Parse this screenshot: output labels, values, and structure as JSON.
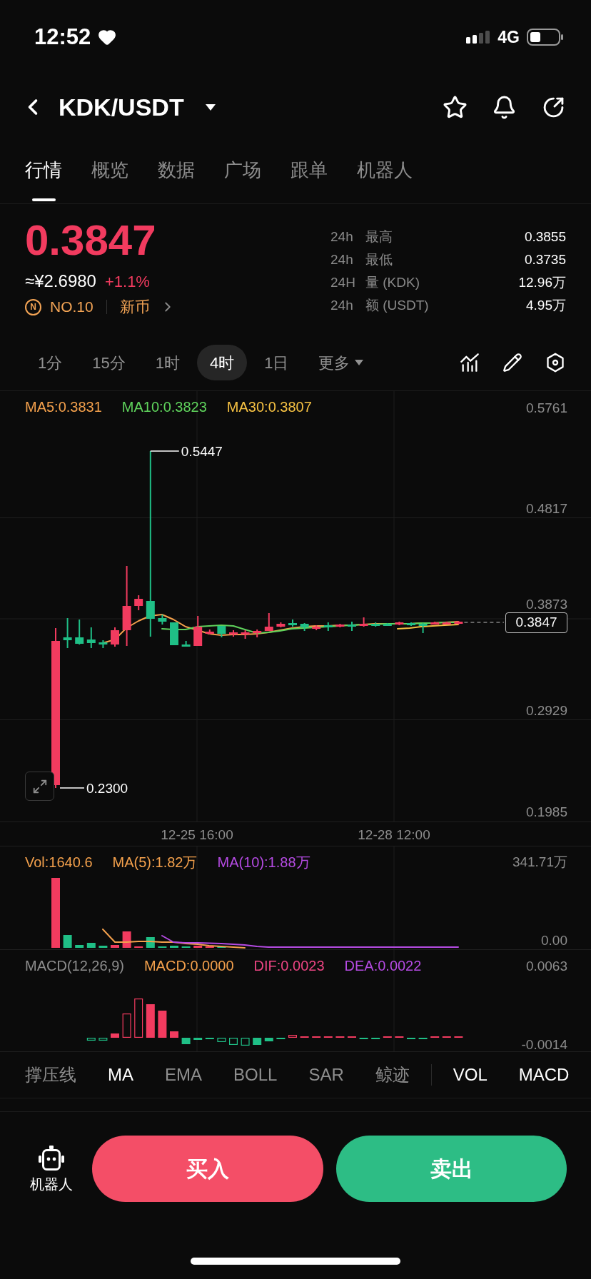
{
  "status_bar": {
    "time": "12:52",
    "network": "4G"
  },
  "header": {
    "pair": "KDK/USDT"
  },
  "tabs": [
    {
      "label": "行情",
      "selected": true
    },
    {
      "label": "概览",
      "selected": false
    },
    {
      "label": "数据",
      "selected": false
    },
    {
      "label": "广场",
      "selected": false
    },
    {
      "label": "跟单",
      "selected": false
    },
    {
      "label": "机器人",
      "selected": false
    }
  ],
  "ticker": {
    "price": "0.3847",
    "fiat_price": "≈¥2.6980",
    "change": "+1.1%",
    "rank_badge": "N",
    "rank": "NO.10",
    "tag": "新币",
    "stats": [
      {
        "period": "24h",
        "label": "最高",
        "value": "0.3855"
      },
      {
        "period": "24h",
        "label": "最低",
        "value": "0.3735"
      },
      {
        "period": "24H",
        "label": "量 (KDK)",
        "value": "12.96万"
      },
      {
        "period": "24h",
        "label": "额 (USDT)",
        "value": "4.95万"
      }
    ]
  },
  "intervals": [
    {
      "label": "1分",
      "selected": false,
      "kind": "option"
    },
    {
      "label": "15分",
      "selected": false,
      "kind": "option"
    },
    {
      "label": "1时",
      "selected": false,
      "kind": "option"
    },
    {
      "label": "4时",
      "selected": true,
      "kind": "option"
    },
    {
      "label": "1日",
      "selected": false,
      "kind": "option"
    },
    {
      "label": "更多",
      "selected": false,
      "kind": "dropdown"
    }
  ],
  "chart": {
    "legend": [
      {
        "label": "MA5:0.3831",
        "color": "#f3a04c"
      },
      {
        "label": "MA10:0.3823",
        "color": "#5fd35c"
      },
      {
        "label": "MA30:0.3807",
        "color": "#f5c143"
      }
    ],
    "y_axis": [
      "0.5761",
      "0.4817",
      "0.3873",
      "0.2929",
      "0.1985"
    ],
    "high_label": "0.5447",
    "low_label": "0.2300",
    "last_price": "0.3847",
    "x_axis": [
      "12-25 16:00",
      "12-28 12:00"
    ]
  },
  "volume": {
    "legend": [
      {
        "label": "Vol:1640.6",
        "color": "#f3a04c"
      },
      {
        "label": "MA(5):1.82万",
        "color": "#f3a04c"
      },
      {
        "label": "MA(10):1.88万",
        "color": "#b54be3"
      }
    ],
    "y_axis": [
      "341.71万",
      "0.00"
    ]
  },
  "macd": {
    "title": "MACD(12,26,9)",
    "legend": [
      {
        "label": "MACD:0.0000",
        "color": "#f3a04c"
      },
      {
        "label": "DIF:0.0023",
        "color": "#ec4583"
      },
      {
        "label": "DEA:0.0022",
        "color": "#b54be3"
      }
    ],
    "y_axis": [
      "0.0063",
      "-0.0014"
    ]
  },
  "indicators": {
    "main": [
      {
        "label": "撑压线",
        "selected": false
      },
      {
        "label": "MA",
        "selected": true
      },
      {
        "label": "EMA",
        "selected": false
      },
      {
        "label": "BOLL",
        "selected": false
      },
      {
        "label": "SAR",
        "selected": false
      },
      {
        "label": "鲸迹",
        "selected": false
      }
    ],
    "sub": [
      {
        "label": "VOL",
        "selected": true
      },
      {
        "label": "MACD",
        "selected": true
      }
    ]
  },
  "actions": {
    "robot": "机器人",
    "buy": "买入",
    "sell": "卖出"
  }
}
